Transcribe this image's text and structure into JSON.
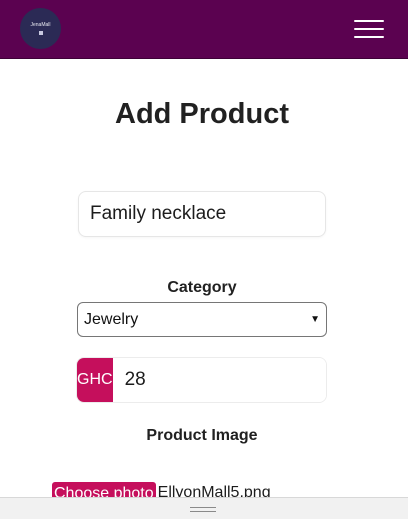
{
  "header": {
    "logo_text": "JenaMall",
    "menu_icon": "hamburger-menu-icon",
    "background_color": "#5b0250"
  },
  "form": {
    "title": "Add Product",
    "product_name_value": "Family necklace",
    "category_label": "Category",
    "category_selected": "Jewelry",
    "price_currency": "GHC",
    "price_value": "28",
    "image_label": "Product Image",
    "choose_photo_label": "Choose photo",
    "file_name": "EllyonMall5.png"
  },
  "colors": {
    "accent": "#c50f5c"
  }
}
